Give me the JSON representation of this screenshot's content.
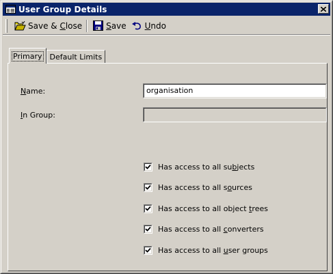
{
  "window": {
    "title": "User Group Details"
  },
  "toolbar": {
    "save_close": {
      "pre": "Save & ",
      "mnemonic": "C",
      "post": "lose"
    },
    "save": {
      "pre": "",
      "mnemonic": "S",
      "post": "ave"
    },
    "undo": {
      "pre": "",
      "mnemonic": "U",
      "post": "ndo"
    }
  },
  "tabs": [
    {
      "label": "Primary",
      "active": true
    },
    {
      "label": "Default Limits",
      "active": false
    }
  ],
  "form": {
    "name": {
      "mnemonic": "N",
      "post": "ame:",
      "value": "organisation"
    },
    "in_group": {
      "mnemonic": "I",
      "post": "n Group:",
      "value": ""
    }
  },
  "checkboxes": [
    {
      "pre": "Has access to all su",
      "mnemonic": "b",
      "post": "jects",
      "checked": true
    },
    {
      "pre": "Has access to all s",
      "mnemonic": "o",
      "post": "urces",
      "checked": true
    },
    {
      "pre": "Has access to all object ",
      "mnemonic": "t",
      "post": "rees",
      "checked": true
    },
    {
      "pre": "Has access to all ",
      "mnemonic": "c",
      "post": "onverters",
      "checked": true
    },
    {
      "pre": "Has access to all ",
      "mnemonic": "u",
      "post": "ser groups",
      "checked": true
    }
  ],
  "colors": {
    "titlebar": "#0a246a",
    "face": "#d4d0c8"
  },
  "icons": {
    "title": "form-icon",
    "save_close": "open-folder-icon",
    "save": "floppy-disk-icon",
    "undo": "undo-arrow-icon",
    "close": "close-icon",
    "check": "checkmark-icon"
  }
}
